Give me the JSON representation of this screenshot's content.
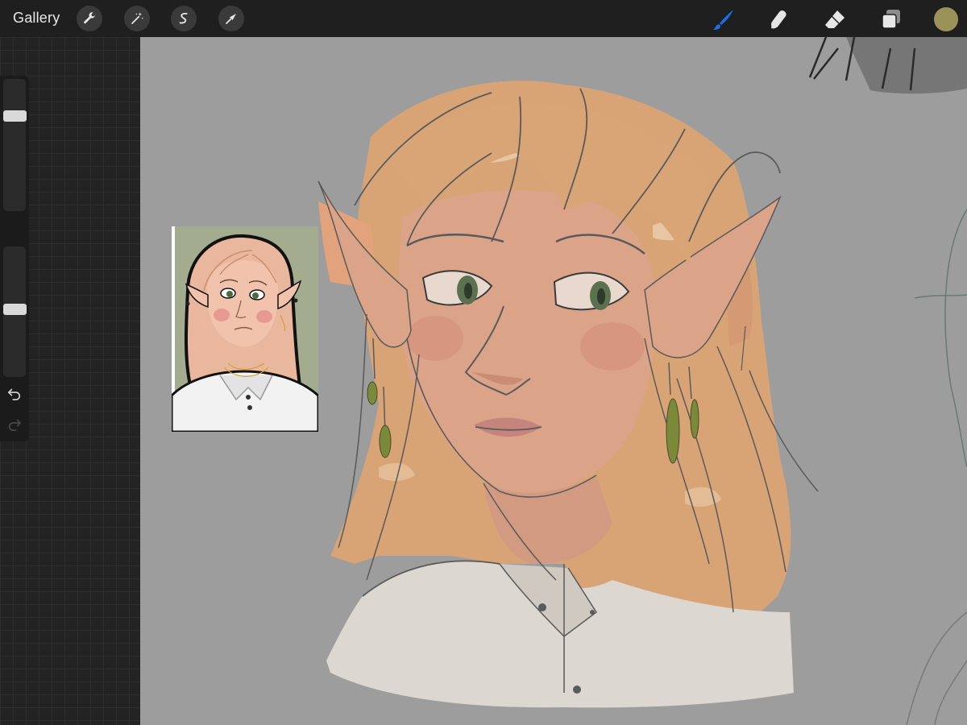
{
  "toolbar": {
    "gallery_label": "Gallery",
    "left_tools": [
      "wrench-icon",
      "magic-wand-icon",
      "selection-icon",
      "transform-arrow-icon"
    ],
    "right_tools": [
      "brush-icon",
      "smudge-icon",
      "eraser-icon",
      "layers-icon"
    ],
    "active_tool": "brush-icon",
    "active_tool_color": "#1a6ee8",
    "current_color": "#9b9259"
  },
  "sidebar": {
    "brush_size_level": 0.74,
    "opacity_level": 0.52,
    "icons": [
      "modify-square-icon",
      "undo-icon",
      "redo-icon"
    ]
  },
  "canvas": {
    "background": "#9d9d9d",
    "reference_image": "elf-portrait-reference",
    "artwork": "elf-portrait-painting"
  }
}
